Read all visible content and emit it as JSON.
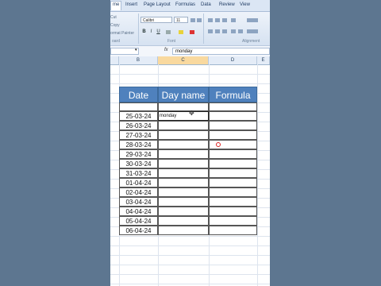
{
  "ribbon": {
    "tabs": [
      "me",
      "Insert",
      "Page Layout",
      "Formulas",
      "Data",
      "Review",
      "View"
    ],
    "clipboard": {
      "cut": "Cut",
      "copy": "Copy",
      "format_painter": "ormat Painter",
      "group_label": "oard"
    },
    "font": {
      "family": "Calibri",
      "size": "11",
      "group_label": "Font"
    },
    "alignment": {
      "group_label": "Alignment"
    },
    "format_buttons": [
      "B",
      "I",
      "U"
    ]
  },
  "formula_bar": {
    "fx": "fx",
    "value": "monday"
  },
  "column_headers": [
    "B",
    "C",
    "D",
    "E"
  ],
  "table": {
    "headers": [
      "Date",
      "Day name",
      "Formula"
    ],
    "rows": [
      {
        "date": "25-03-24",
        "day_name": "monday",
        "formula": ""
      },
      {
        "date": "26-03-24",
        "day_name": "",
        "formula": ""
      },
      {
        "date": "27-03-24",
        "day_name": "",
        "formula": ""
      },
      {
        "date": "28-03-24",
        "day_name": "",
        "formula": ""
      },
      {
        "date": "29-03-24",
        "day_name": "",
        "formula": ""
      },
      {
        "date": "30-03-24",
        "day_name": "",
        "formula": ""
      },
      {
        "date": "31-03-24",
        "day_name": "",
        "formula": ""
      },
      {
        "date": "01-04-24",
        "day_name": "",
        "formula": ""
      },
      {
        "date": "02-04-24",
        "day_name": "",
        "formula": ""
      },
      {
        "date": "03-04-24",
        "day_name": "",
        "formula": ""
      },
      {
        "date": "04-04-24",
        "day_name": "",
        "formula": ""
      },
      {
        "date": "05-04-24",
        "day_name": "",
        "formula": ""
      },
      {
        "date": "06-04-24",
        "day_name": "",
        "formula": ""
      }
    ]
  },
  "colors": {
    "header_fill": "#4f81bd",
    "background": "#5d7690",
    "selected_col": "#f9d99f"
  }
}
